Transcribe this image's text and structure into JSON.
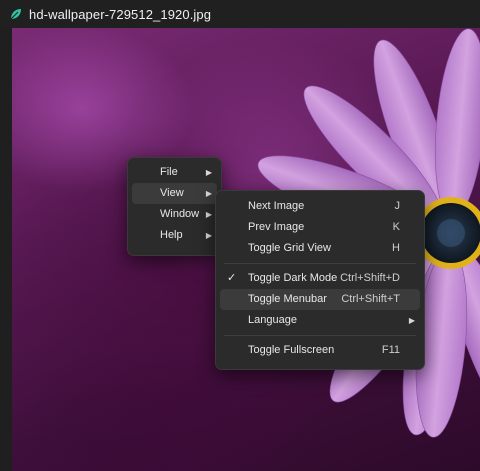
{
  "window": {
    "title": "hd-wallpaper-729512_1920.jpg",
    "app_icon": "leaf-icon",
    "accent": "#2ec4a6"
  },
  "image": {
    "description_icon": "flower-photo",
    "background": "#5a1a55",
    "petal_color": "#c78ad6",
    "center_color": "#1b2a3a",
    "pollen_color": "#e0b21a"
  },
  "menu": {
    "items": [
      {
        "label": "File",
        "has_submenu": true
      },
      {
        "label": "View",
        "has_submenu": true,
        "active": true
      },
      {
        "label": "Window",
        "has_submenu": true
      },
      {
        "label": "Help",
        "has_submenu": true
      }
    ]
  },
  "view_submenu": {
    "items": [
      {
        "label": "Next Image",
        "shortcut": "J"
      },
      {
        "label": "Prev Image",
        "shortcut": "K"
      },
      {
        "label": "Toggle Grid View",
        "shortcut": "H"
      },
      {
        "label": "Toggle Dark Mode",
        "shortcut": "Ctrl+Shift+D",
        "checked": true
      },
      {
        "label": "Toggle Menubar",
        "shortcut": "Ctrl+Shift+T",
        "active": true
      },
      {
        "label": "Language",
        "has_submenu": true
      },
      {
        "label": "Toggle Fullscreen",
        "shortcut": "F11"
      }
    ]
  }
}
